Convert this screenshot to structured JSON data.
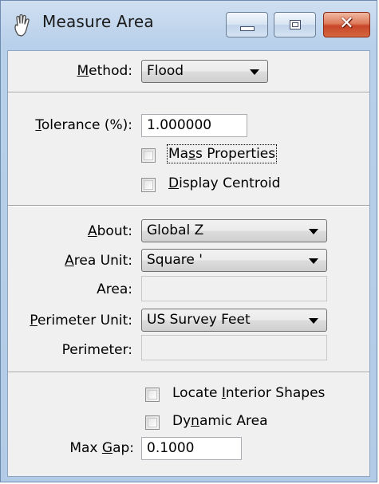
{
  "window": {
    "title": "Measure Area",
    "icon": "measure-area-hand-icon"
  },
  "controls": {
    "minimize_icon": "minimize-icon",
    "maximize_icon": "maximize-icon",
    "close_glyph": "✕"
  },
  "method": {
    "label_prefix": "",
    "label_u": "M",
    "label_suffix": "ethod:",
    "value": "Flood"
  },
  "tolerance": {
    "label_u": "T",
    "label_suffix": "olerance (%):",
    "value": "1.000000"
  },
  "mass_properties": {
    "label_prefix": "Ma",
    "label_u": "s",
    "label_suffix": "s Properties",
    "checked": false
  },
  "display_centroid": {
    "label_prefix": "",
    "label_u": "D",
    "label_suffix": "isplay Centroid",
    "checked": false
  },
  "about": {
    "label_u": "A",
    "label_suffix": "bout:",
    "value": "Global Z"
  },
  "area_unit": {
    "label_u": "A",
    "label_suffix": "rea Unit:",
    "value": "Square '"
  },
  "area": {
    "label": "Area:",
    "value": ""
  },
  "perimeter_unit": {
    "label_u": "P",
    "label_suffix": "erimeter Unit:",
    "value": "US Survey Feet"
  },
  "perimeter": {
    "label": "Perimeter:",
    "value": ""
  },
  "locate_interior": {
    "label_prefix": "Locate ",
    "label_u": "I",
    "label_suffix": "nterior Shapes",
    "checked": false
  },
  "dynamic_area": {
    "label_prefix": "Dy",
    "label_u": "n",
    "label_suffix": "amic Area",
    "checked": false
  },
  "max_gap": {
    "label_prefix": "Max ",
    "label_u": "G",
    "label_suffix": "ap:",
    "value": "0.1000"
  }
}
